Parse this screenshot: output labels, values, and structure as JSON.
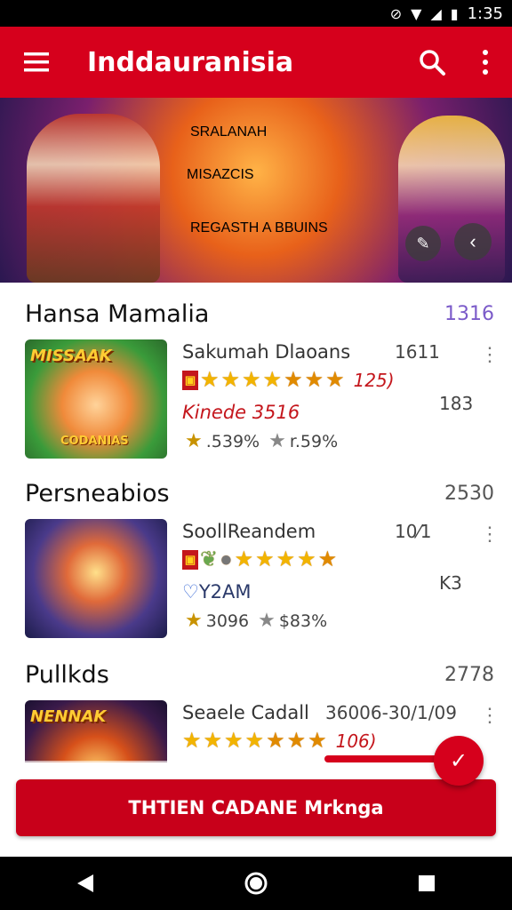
{
  "status_bar": {
    "time": "1:35"
  },
  "app_bar": {
    "title": "Inddauranisia"
  },
  "banner": {
    "title_line1": "SRALANAH",
    "title_line2": "MISAZCIS",
    "subtitle": "REGASTH A BBUINS"
  },
  "sections": [
    {
      "title": "Hansa Mamalia",
      "count": "1316",
      "item": {
        "thumb_title": "MISSAAK",
        "thumb_sub": "CODANIAS",
        "name": "Sakumah Dlaoans",
        "number1": "1611",
        "rating_value": "125)",
        "tag": "Kinede 3516",
        "number2": "183",
        "stat1": ".539%",
        "stat2": "r.59%"
      }
    },
    {
      "title": "Persneabios",
      "count": "2530",
      "item": {
        "name": "SoollReandem",
        "number1": "10⁄‎1",
        "tag": "Y2AM",
        "number2": "K3",
        "stat1": "3096",
        "stat2": "$83%"
      }
    },
    {
      "title": "Pullkds",
      "count": "2778",
      "item": {
        "thumb_title": "NENNAK",
        "name": "Seaele Cadall",
        "number1": "36006-30/1/09",
        "rating_value": "106)"
      }
    }
  ],
  "cta": {
    "label": "THTIEN CADANE Mrknga"
  },
  "icons": {
    "menu": "menu-icon",
    "search": "search-icon",
    "more": "more-vert-icon",
    "fab": "check-icon"
  },
  "colors": {
    "primary": "#d6001c",
    "accent_star": "#f2b400"
  }
}
